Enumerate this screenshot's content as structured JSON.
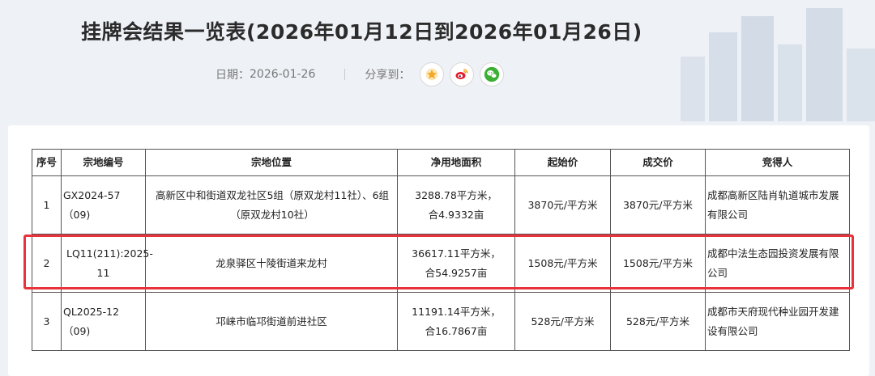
{
  "page": {
    "title": "挂牌会结果一览表(2026年01月12日到2026年01月26日)",
    "date_label": "日期：",
    "date_value": "2026-01-26",
    "share_label": "分享到：",
    "share_icons": [
      "star-icon",
      "weibo-icon",
      "wechat-icon"
    ]
  },
  "table": {
    "headers": [
      "序号",
      "宗地编号",
      "宗地位置",
      "净用地面积",
      "起始价",
      "成交价",
      "竞得人"
    ],
    "rows": [
      {
        "no": "1",
        "code": "GX2024-57（09)",
        "location": "高新区中和街道双龙社区5组（原双龙村11社）、6组（原双龙村10社）",
        "area": "3288.78平方米，合4.9332亩",
        "start_price": "3870元/平方米",
        "deal_price": "3870元/平方米",
        "winner": "成都高新区陆肖轨道城市发展有限公司"
      },
      {
        "no": "2",
        "code": "LQ11(211):2025-11",
        "location": "龙泉驿区十陵街道来龙村",
        "area": "36617.11平方米，合54.9257亩",
        "start_price": "1508元/平方米",
        "deal_price": "1508元/平方米",
        "winner": "成都中法生态园投资发展有限公司"
      },
      {
        "no": "3",
        "code": "QL2025-12（09)",
        "location": "邛崃市临邛街道前进社区",
        "area": "11191.14平方米，合16.7867亩",
        "start_price": "528元/平方米",
        "deal_price": "528元/平方米",
        "winner": "成都市天府现代种业园开发建设有限公司"
      }
    ]
  },
  "colors": {
    "highlight": "#e8323c",
    "star": "#f5a623",
    "weibo": "#e6162d",
    "wechat": "#3cb034"
  }
}
